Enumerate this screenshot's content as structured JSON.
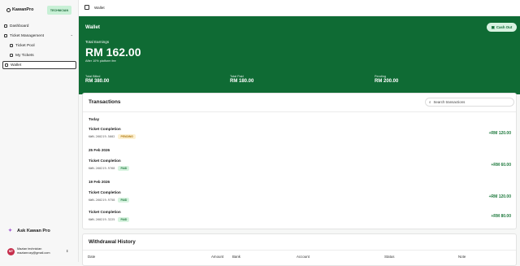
{
  "sidebar": {
    "brand": "KawanPro",
    "role_badge": "TECHNICIAN",
    "items": [
      {
        "label": "Dashboard"
      },
      {
        "label": "Ticket Management"
      },
      {
        "label": "Ticket Pool"
      },
      {
        "label": "My Tickets"
      },
      {
        "label": "Wallet"
      }
    ],
    "ask": "Ask Kawan Pro",
    "user": {
      "initials": "MT",
      "name": "Mazian technician",
      "email": "mazianrozy@gmail.com"
    }
  },
  "topbar": {
    "title": "Wallet"
  },
  "hero": {
    "heading": "Wallet",
    "cash_out_label": "Cash Out",
    "total_earnings_label": "Total Earnings",
    "total_earnings_value": "RM 162.00",
    "fee_note": "After 10% platform fee",
    "stats": [
      {
        "label": "Total Billed",
        "value": "RM 380.00"
      },
      {
        "label": "Total Paid",
        "value": "RM 180.00"
      },
      {
        "label": "Pending",
        "value": "RM 200.00"
      }
    ]
  },
  "transactions": {
    "heading": "Transactions",
    "search_placeholder": "Search transactions",
    "groups": [
      {
        "date": "Today",
        "rows": [
          {
            "name": "Ticket Completion",
            "id": "KWN-260219-5002",
            "status": "PENDING",
            "amount": "+RM 120.00"
          }
        ]
      },
      {
        "date": "25 Feb 2026",
        "rows": [
          {
            "name": "Ticket Completion",
            "id": "KWN-260219-9768",
            "status": "PAID",
            "amount": "+RM 60.00"
          }
        ]
      },
      {
        "date": "19 Feb 2026",
        "rows": [
          {
            "name": "Ticket Completion",
            "id": "KWN-260219-9758",
            "status": "PAID",
            "amount": "+RM 120.00"
          },
          {
            "name": "Ticket Completion",
            "id": "KWN-260219-3225",
            "status": "PAID",
            "amount": "+RM 80.00"
          }
        ]
      }
    ]
  },
  "withdrawals": {
    "heading": "Withdrawal History",
    "columns": [
      "Date",
      "Amount",
      "Bank",
      "Account",
      "Status",
      "Note"
    ]
  },
  "colors": {
    "brand_green": "#0f6b34",
    "paid_green": "#1f7a3e",
    "pending_amber": "#b07a10",
    "avatar": "#c62d4b"
  }
}
